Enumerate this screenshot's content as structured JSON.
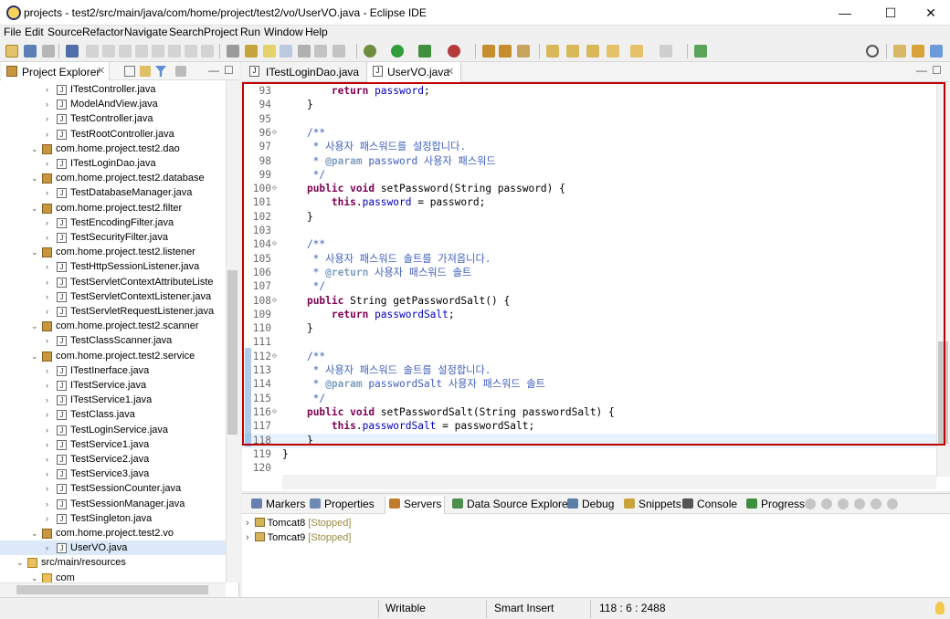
{
  "window": {
    "title": "projects - test2/src/main/java/com/home/project/test2/vo/UserVO.java - Eclipse IDE",
    "minimize": "—",
    "maximize": "☐",
    "close": "✕"
  },
  "menu": [
    "File",
    "Edit",
    "Source",
    "Refactor",
    "Navigate",
    "Search",
    "Project",
    "Run",
    "Window",
    "Help"
  ],
  "explorer": {
    "tab_label": "Project Explorer",
    "tree": [
      {
        "label": "ITestController.java",
        "kind": "java",
        "level": 2
      },
      {
        "label": "ModelAndView.java",
        "kind": "java",
        "level": 2
      },
      {
        "label": "TestController.java",
        "kind": "java",
        "level": 2
      },
      {
        "label": "TestRootController.java",
        "kind": "java",
        "level": 2
      },
      {
        "label": "com.home.project.test2.dao",
        "kind": "pkg",
        "level": 1
      },
      {
        "label": "ITestLoginDao.java",
        "kind": "java",
        "level": 2
      },
      {
        "label": "com.home.project.test2.database",
        "kind": "pkg",
        "level": 1
      },
      {
        "label": "TestDatabaseManager.java",
        "kind": "java",
        "level": 2
      },
      {
        "label": "com.home.project.test2.filter",
        "kind": "pkg",
        "level": 1
      },
      {
        "label": "TestEncodingFilter.java",
        "kind": "java",
        "level": 2
      },
      {
        "label": "TestSecurityFilter.java",
        "kind": "java",
        "level": 2
      },
      {
        "label": "com.home.project.test2.listener",
        "kind": "pkg",
        "level": 1
      },
      {
        "label": "TestHttpSessionListener.java",
        "kind": "java",
        "level": 2
      },
      {
        "label": "TestServletContextAttributeListe",
        "kind": "java",
        "level": 2
      },
      {
        "label": "TestServletContextListener.java",
        "kind": "java",
        "level": 2
      },
      {
        "label": "TestServletRequestListener.java",
        "kind": "java",
        "level": 2
      },
      {
        "label": "com.home.project.test2.scanner",
        "kind": "pkg",
        "level": 1
      },
      {
        "label": "TestClassScanner.java",
        "kind": "java",
        "level": 2
      },
      {
        "label": "com.home.project.test2.service",
        "kind": "pkg",
        "level": 1
      },
      {
        "label": "ITestInerface.java",
        "kind": "java",
        "level": 2
      },
      {
        "label": "ITestService.java",
        "kind": "java",
        "level": 2
      },
      {
        "label": "ITestService1.java",
        "kind": "java",
        "level": 2
      },
      {
        "label": "TestClass.java",
        "kind": "java",
        "level": 2
      },
      {
        "label": "TestLoginService.java",
        "kind": "java",
        "level": 2
      },
      {
        "label": "TestService1.java",
        "kind": "java",
        "level": 2
      },
      {
        "label": "TestService2.java",
        "kind": "java",
        "level": 2
      },
      {
        "label": "TestService3.java",
        "kind": "java",
        "level": 2
      },
      {
        "label": "TestSessionCounter.java",
        "kind": "java",
        "level": 2
      },
      {
        "label": "TestSessionManager.java",
        "kind": "java",
        "level": 2
      },
      {
        "label": "TestSingleton.java",
        "kind": "java",
        "level": 2
      },
      {
        "label": "com.home.project.test2.vo",
        "kind": "pkg",
        "level": 1
      },
      {
        "label": "UserVO.java",
        "kind": "java",
        "level": 2,
        "selected": true
      },
      {
        "label": "src/main/resources",
        "kind": "folder",
        "level": 0
      },
      {
        "label": "com",
        "kind": "folder",
        "level": 1
      }
    ]
  },
  "editor": {
    "tabs": [
      {
        "label": "ITestLoginDao.java",
        "active": false
      },
      {
        "label": "UserVO.java",
        "active": true,
        "close": "✕"
      }
    ],
    "lines": [
      {
        "n": "93",
        "tokens": [
          [
            "        ",
            ""
          ],
          [
            "return",
            "kw"
          ],
          [
            " ",
            ""
          ],
          [
            "password",
            "fld"
          ],
          [
            ";",
            ""
          ]
        ]
      },
      {
        "n": "94",
        "tokens": [
          [
            "    }",
            ""
          ]
        ]
      },
      {
        "n": "95",
        "tokens": []
      },
      {
        "n": "96",
        "fold": true,
        "tokens": [
          [
            "    /**",
            "cmt"
          ]
        ]
      },
      {
        "n": "97",
        "tokens": [
          [
            "     * 사용자 패스워드를 설정합니다.",
            "cmt"
          ]
        ]
      },
      {
        "n": "98",
        "tokens": [
          [
            "     * ",
            "cmt"
          ],
          [
            "@param",
            "tag"
          ],
          [
            " password 사용자 패스워드",
            "cmt"
          ]
        ]
      },
      {
        "n": "99",
        "tokens": [
          [
            "     */",
            "cmt"
          ]
        ]
      },
      {
        "n": "100",
        "fold": true,
        "tokens": [
          [
            "    ",
            ""
          ],
          [
            "public",
            "kw"
          ],
          [
            " ",
            ""
          ],
          [
            "void",
            "kw"
          ],
          [
            " setPassword(String password) {",
            ""
          ]
        ]
      },
      {
        "n": "101",
        "tokens": [
          [
            "        ",
            ""
          ],
          [
            "this",
            "kw"
          ],
          [
            ".",
            ""
          ],
          [
            "password",
            "fld"
          ],
          [
            " = password;",
            ""
          ]
        ]
      },
      {
        "n": "102",
        "tokens": [
          [
            "    }",
            ""
          ]
        ]
      },
      {
        "n": "103",
        "tokens": []
      },
      {
        "n": "104",
        "fold": true,
        "tokens": [
          [
            "    /**",
            "cmt"
          ]
        ]
      },
      {
        "n": "105",
        "tokens": [
          [
            "     * 사용자 패스워드 솔트를 가져옵니다.",
            "cmt"
          ]
        ]
      },
      {
        "n": "106",
        "tokens": [
          [
            "     * ",
            "cmt"
          ],
          [
            "@return",
            "tag"
          ],
          [
            " 사용자 패스워드 솔트",
            "cmt"
          ]
        ]
      },
      {
        "n": "107",
        "tokens": [
          [
            "     */",
            "cmt"
          ]
        ]
      },
      {
        "n": "108",
        "fold": true,
        "tokens": [
          [
            "    ",
            ""
          ],
          [
            "public",
            "kw"
          ],
          [
            " String getPasswordSalt() {",
            ""
          ]
        ]
      },
      {
        "n": "109",
        "tokens": [
          [
            "        ",
            ""
          ],
          [
            "return",
            "kw"
          ],
          [
            " ",
            ""
          ],
          [
            "passwordSalt",
            "fld"
          ],
          [
            ";",
            ""
          ]
        ]
      },
      {
        "n": "110",
        "tokens": [
          [
            "    }",
            ""
          ]
        ]
      },
      {
        "n": "111",
        "tokens": []
      },
      {
        "n": "112",
        "fold": true,
        "tokens": [
          [
            "    /**",
            "cmt"
          ]
        ]
      },
      {
        "n": "113",
        "tokens": [
          [
            "     * 사용자 패스워드 솔트를 설정합니다.",
            "cmt"
          ]
        ]
      },
      {
        "n": "114",
        "tokens": [
          [
            "     * ",
            "cmt"
          ],
          [
            "@param",
            "tag"
          ],
          [
            " passwordSalt 사용자 패스워드 솔트",
            "cmt"
          ]
        ]
      },
      {
        "n": "115",
        "tokens": [
          [
            "     */",
            "cmt"
          ]
        ]
      },
      {
        "n": "116",
        "fold": true,
        "tokens": [
          [
            "    ",
            ""
          ],
          [
            "public",
            "kw"
          ],
          [
            " ",
            ""
          ],
          [
            "void",
            "kw"
          ],
          [
            " setPasswordSalt(String passwordSalt) {",
            ""
          ]
        ]
      },
      {
        "n": "117",
        "tokens": [
          [
            "        ",
            ""
          ],
          [
            "this",
            "kw"
          ],
          [
            ".",
            ""
          ],
          [
            "passwordSalt",
            "fld"
          ],
          [
            " = passwordSalt;",
            ""
          ]
        ]
      },
      {
        "n": "118",
        "current": true,
        "tokens": [
          [
            "    }",
            ""
          ]
        ]
      },
      {
        "n": "119",
        "tokens": [
          [
            "}",
            ""
          ]
        ]
      },
      {
        "n": "120",
        "tokens": []
      }
    ]
  },
  "servers": {
    "tabs": [
      "Markers",
      "Properties",
      "Servers",
      "Data Source Explorer",
      "Debug",
      "Snippets",
      "Console",
      "Progress"
    ],
    "active_tab": "Servers",
    "entries": [
      {
        "name": "Tomcat8",
        "status": "[Stopped]"
      },
      {
        "name": "Tomcat9",
        "status": "[Stopped]"
      }
    ]
  },
  "statusbar": {
    "writable": "Writable",
    "insert_mode": "Smart Insert",
    "position": "118 : 6 : 2488"
  },
  "colors": {
    "highlight_box": "#c00000",
    "keyword": "#7f0055",
    "field": "#0000c0",
    "comment": "#3f5fbf"
  }
}
